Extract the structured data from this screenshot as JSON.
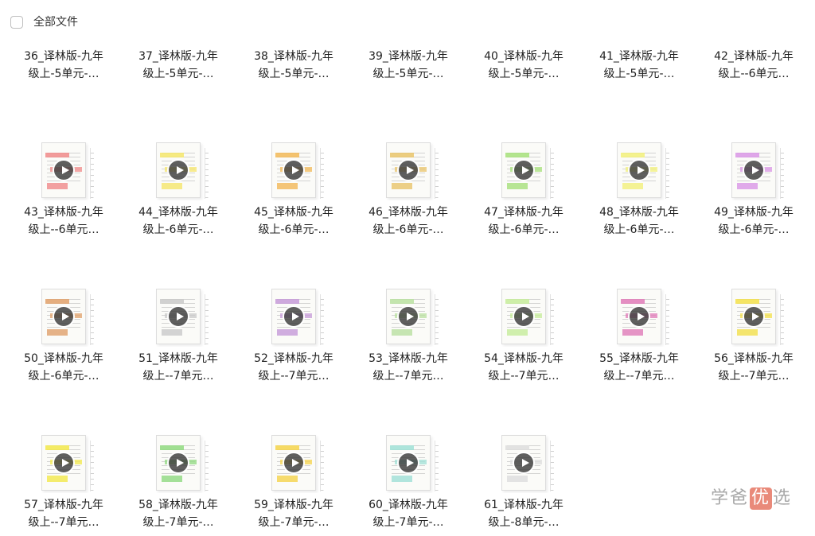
{
  "header": {
    "select_all_label": "全部文件"
  },
  "watermark": {
    "left": "学爸",
    "mid": "优",
    "right": "选"
  },
  "files": [
    {
      "line1": "36_译林版-九年",
      "line2": "级上-5单元-…",
      "hl": "#f3d37a"
    },
    {
      "line1": "37_译林版-九年",
      "line2": "级上-5单元-…",
      "hl": "#d9c88f"
    },
    {
      "line1": "38_译林版-九年",
      "line2": "级上-5单元-…",
      "hl": "#e5e5e5"
    },
    {
      "line1": "39_译林版-九年",
      "line2": "级上-5单元-…",
      "hl": "#9fd98f"
    },
    {
      "line1": "40_译林版-九年",
      "line2": "级上-5单元-…",
      "hl": "#e58fd6"
    },
    {
      "line1": "41_译林版-九年",
      "line2": "级上-5单元-…",
      "hl": "#dddddd"
    },
    {
      "line1": "42_译林版-九年",
      "line2": "级上--6单元…",
      "hl": "#f0e45a"
    },
    {
      "line1": "43_译林版-九年",
      "line2": "级上--6单元…",
      "hl": "#f08a8a"
    },
    {
      "line1": "44_译林版-九年",
      "line2": "级上-6单元-…",
      "hl": "#f5e66b"
    },
    {
      "line1": "45_译林版-九年",
      "line2": "级上-6单元-…",
      "hl": "#f2b857"
    },
    {
      "line1": "46_译林版-九年",
      "line2": "级上-6单元-…",
      "hl": "#e9c46a"
    },
    {
      "line1": "47_译林版-九年",
      "line2": "级上-6单元-…",
      "hl": "#a6e07a"
    },
    {
      "line1": "48_译林版-九年",
      "line2": "级上-6单元-…",
      "hl": "#f2f07a"
    },
    {
      "line1": "49_译林版-九年",
      "line2": "级上-6单元-…",
      "hl": "#d996e6"
    },
    {
      "line1": "50_译林版-九年",
      "line2": "级上-6单元-…",
      "hl": "#e0a06a"
    },
    {
      "line1": "51_译林版-九年",
      "line2": "级上--7单元…",
      "hl": "#c9c9c9"
    },
    {
      "line1": "52_译林版-九年",
      "line2": "级上--7单元…",
      "hl": "#c69ad8"
    },
    {
      "line1": "53_译林版-九年",
      "line2": "级上--7单元…",
      "hl": "#b9e0a0"
    },
    {
      "line1": "54_译林版-九年",
      "line2": "级上--7单元…",
      "hl": "#c5ec9a"
    },
    {
      "line1": "55_译林版-九年",
      "line2": "级上--7单元…",
      "hl": "#e07ab8"
    },
    {
      "line1": "56_译林版-九年",
      "line2": "级上--7单元…",
      "hl": "#f3e04a"
    },
    {
      "line1": "57_译林版-九年",
      "line2": "级上--7单元…",
      "hl": "#f2e84a"
    },
    {
      "line1": "58_译林版-九年",
      "line2": "级上-7单元-…",
      "hl": "#8fd97f"
    },
    {
      "line1": "59_译林版-九年",
      "line2": "级上-7单元-…",
      "hl": "#f5d34a"
    },
    {
      "line1": "60_译林版-九年",
      "line2": "级上-7单元-…",
      "hl": "#9fe0d6"
    },
    {
      "line1": "61_译林版-九年",
      "line2": "级上-8单元-…",
      "hl": "#dddddd"
    }
  ]
}
